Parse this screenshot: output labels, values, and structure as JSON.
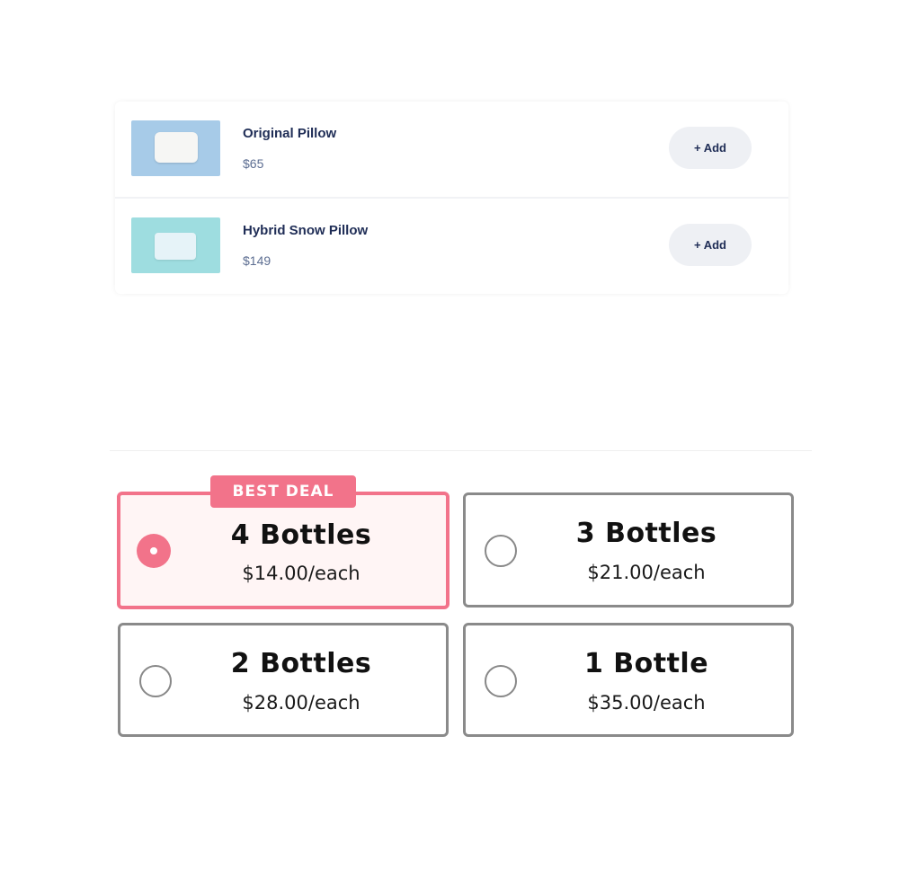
{
  "products": [
    {
      "name": "Original Pillow",
      "price": "$65",
      "add_label": "+ Add",
      "thumb_bg": "#a7cbe8"
    },
    {
      "name": "Hybrid Snow Pillow",
      "price": "$149",
      "add_label": "+ Add",
      "thumb_bg": "#9edde0"
    }
  ],
  "bundle": {
    "badge": "BEST DEAL",
    "accent_color": "#f2738a",
    "selected": "4 Bottles",
    "options": [
      {
        "title": "4 Bottles",
        "price": "$14.00/each",
        "selected": true
      },
      {
        "title": "3 Bottles",
        "price": "$21.00/each",
        "selected": false
      },
      {
        "title": "2 Bottles",
        "price": "$28.00/each",
        "selected": false
      },
      {
        "title": "1 Bottle",
        "price": "$35.00/each",
        "selected": false
      }
    ]
  }
}
